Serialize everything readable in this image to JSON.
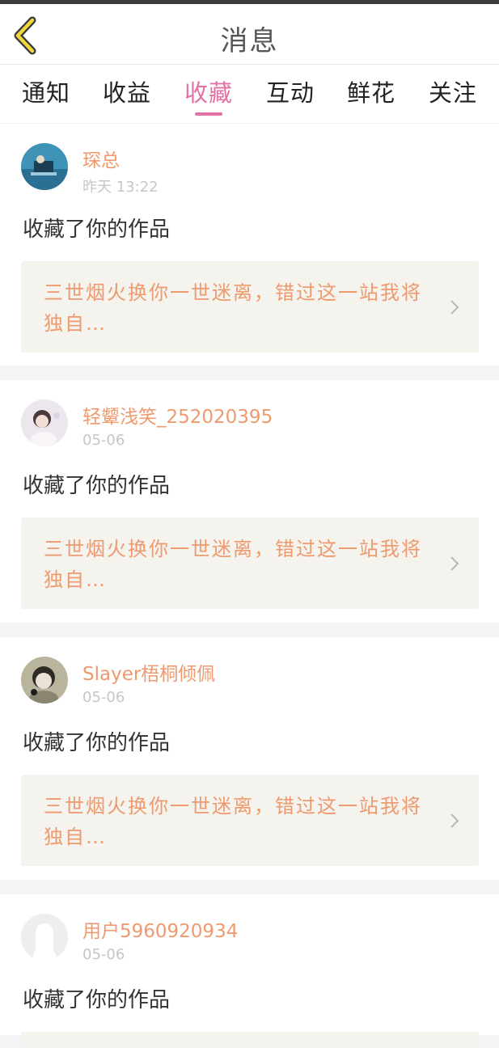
{
  "header": {
    "title": "消息"
  },
  "tabs": [
    {
      "label": "通知"
    },
    {
      "label": "收益"
    },
    {
      "label": "收藏"
    },
    {
      "label": "互动"
    },
    {
      "label": "鲜花"
    },
    {
      "label": "关注"
    }
  ],
  "active_tab": "收藏",
  "colors": {
    "accent": "#e371a6",
    "username": "#ef9a6e",
    "quote_bg": "#f4f3ee"
  },
  "messages": [
    {
      "username": "琛总",
      "time": "昨天 13:22",
      "action": "收藏了你的作品",
      "work": "三世烟火换你一世迷离，错过这一站我将独自…"
    },
    {
      "username": "轻颦浅笑_252020395",
      "time": "05-06",
      "action": "收藏了你的作品",
      "work": "三世烟火换你一世迷离，错过这一站我将独自…"
    },
    {
      "username": "Slayer梧桐倾佩",
      "time": "05-06",
      "action": "收藏了你的作品",
      "work": "三世烟火换你一世迷离，错过这一站我将独自…"
    },
    {
      "username": "用户5960920934",
      "time": "05-06",
      "action": "收藏了你的作品",
      "work": ""
    }
  ]
}
